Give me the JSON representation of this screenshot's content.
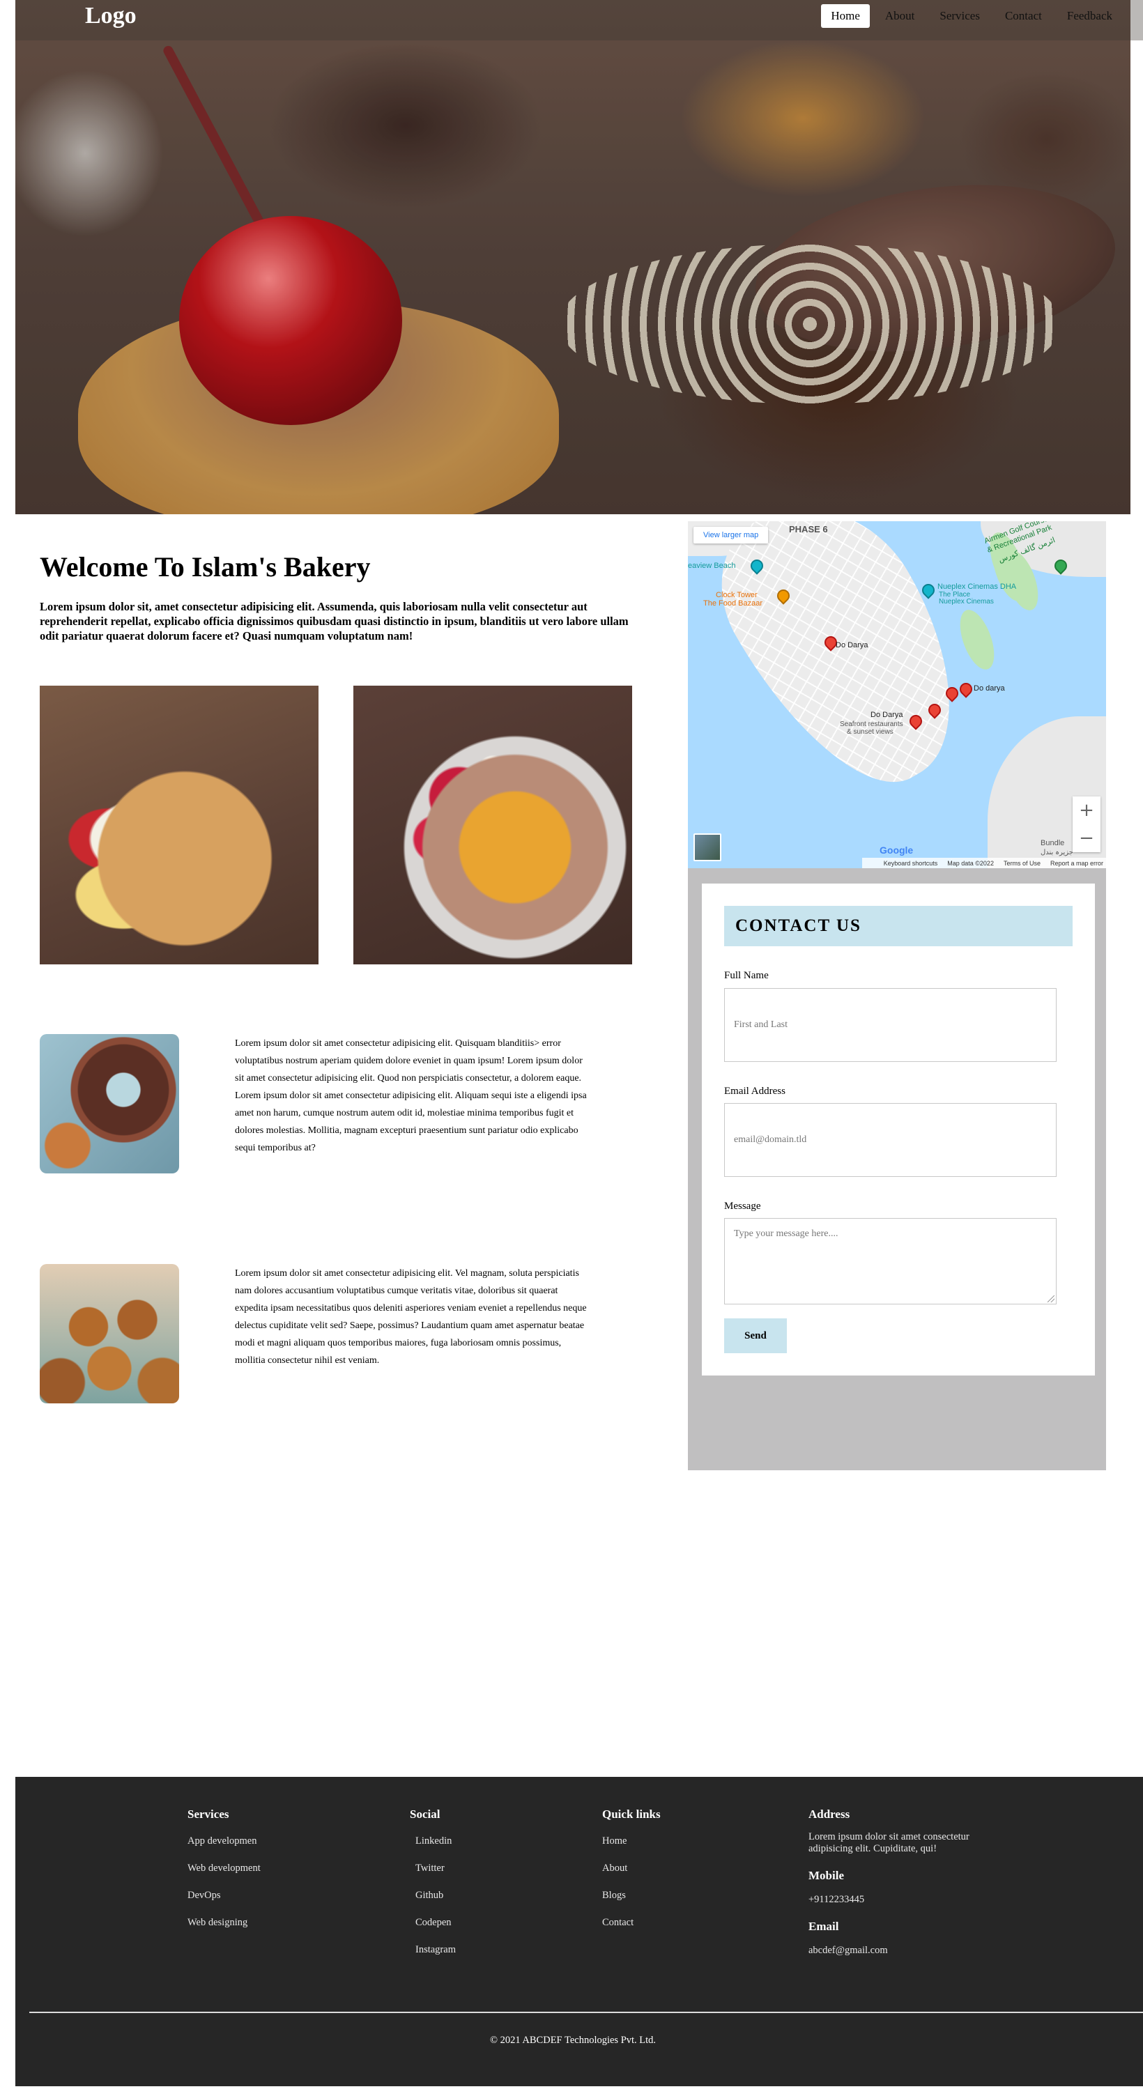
{
  "nav": {
    "logo": "Logo",
    "links": [
      "Home",
      "About",
      "Services",
      "Contact",
      "Feedback"
    ],
    "active": "Home"
  },
  "welcome": {
    "title": "Welcome To Islam's Bakery",
    "text": "Lorem ipsum dolor sit, amet consectetur adipisicing elit. Assumenda, quis laboriosam nulla velit consectetur aut reprehenderit repellat, explicabo officia dignissimos quibusdam quasi distinctio in ipsum, blanditiis ut vero labore ullam odit pariatur quaerat dolorum facere et? Quasi numquam voluptatum nam!"
  },
  "paragraphs": [
    "Lorem ipsum dolor sit amet consectetur adipisicing elit. Quisquam blanditiis> error voluptatibus nostrum aperiam quidem dolore eveniet in quam ipsum! Lorem ipsum dolor sit amet consectetur adipisicing elit. Quod non perspiciatis consectetur, a dolorem eaque. Lorem ipsum dolor sit amet consectetur adipisicing elit. Aliquam sequi iste a eligendi ipsa amet non harum, cumque nostrum autem odit id, molestiae minima temporibus fugit et dolores molestias. Mollitia, magnam excepturi praesentium sunt pariatur odio explicabo sequi temporibus at?",
    "Lorem ipsum dolor sit amet consectetur adipisicing elit. Vel magnam, soluta perspiciatis nam dolores accusantium voluptatibus cumque veritatis vitae, doloribus sit quaerat expedita ipsam necessitatibus quos deleniti asperiores veniam eveniet a repellendus neque delectus cupiditate velit sed? Saepe, possimus? Laudantium quam amet aspernatur beatae modi et magni aliquam quos temporibus maiores, fuga laboriosam omnis possimus, mollitia consectetur nihil est veniam."
  ],
  "map": {
    "larger_map": "View larger map",
    "labels": {
      "phase6": "PHASE 6",
      "airmen": "Airmen Golf Course",
      "airmen2": "& Recreational Park",
      "airmen_ur": "ائرمن گالف کورس",
      "seaview": "eaview Beach",
      "clock1": "Clock Tower",
      "clock2": "The Food Bazaar",
      "nueplex": "Nueplex Cinemas DHA",
      "theplace1": "The Place",
      "theplace2": "Nueplex Cinemas",
      "dodarya1": "Do Darya",
      "dodarya2": "Do darya",
      "dodarya3": "Do Darya",
      "seafront1": "Seafront restaurants",
      "seafront2": "& sunset views",
      "bundle": "Bundle",
      "bundle_ur": "جزیرہ بندل"
    },
    "google": "Google",
    "footer": [
      "Keyboard shortcuts",
      "Map data ©2022",
      "Terms of Use",
      "Report a map error"
    ],
    "zoom_in": "+",
    "zoom_out": "−"
  },
  "contact": {
    "title": "CONTACT US",
    "name_label": "Full Name",
    "name_placeholder": "First and Last",
    "email_label": "Email Address",
    "email_placeholder": "email@domain.tld",
    "message_label": "Message",
    "message_placeholder": "Type your message here....",
    "send": "Send"
  },
  "footer": {
    "services": {
      "title": "Services",
      "items": [
        "App developmen",
        "Web development",
        "DevOps",
        "Web designing"
      ]
    },
    "social": {
      "title": "Social",
      "items": [
        "Linkedin",
        "Twitter",
        "Github",
        "Codepen",
        "Instagram"
      ]
    },
    "quick": {
      "title": "Quick links",
      "items": [
        "Home",
        "About",
        "Blogs",
        "Contact"
      ]
    },
    "address": {
      "title": "Address",
      "text": "Lorem ipsum dolor sit amet consectetur adipisicing elit. Cupiditate, qui!",
      "mobile_title": "Mobile",
      "mobile": "+9112233445",
      "email_title": "Email",
      "email": "abcdef@gmail.com"
    },
    "copyright": "© 2021 ABCDEF Technologies Pvt. Ltd."
  }
}
